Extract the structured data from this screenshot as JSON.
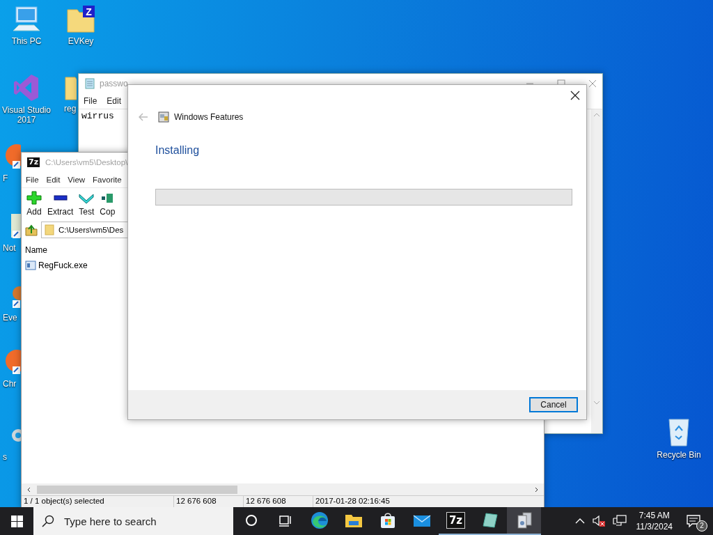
{
  "desktop_icons": [
    {
      "label": "This PC",
      "kind": "computer"
    },
    {
      "label": "EVKey",
      "kind": "folder",
      "badge": "Z"
    },
    {
      "label": "Visual Studio 2017",
      "kind": "visual-studio"
    },
    {
      "label": "reg",
      "kind": "folder"
    },
    {
      "label": "F",
      "kind": "browser"
    },
    {
      "label": "Not",
      "kind": "notepad"
    },
    {
      "label": "Eve",
      "kind": "viewer"
    },
    {
      "label": "Chr",
      "kind": "browser"
    },
    {
      "label": "s",
      "kind": "tool"
    },
    {
      "label": "Recycle Bin",
      "kind": "recycle-bin"
    }
  ],
  "notepad": {
    "title": "passwo",
    "menu": [
      "File",
      "Edit"
    ],
    "text": "wirrus"
  },
  "seven_zip": {
    "logo": "7z",
    "title": "C:\\Users\\vm5\\Desktop\\",
    "menu": [
      "File",
      "Edit",
      "View",
      "Favorite"
    ],
    "toolbar": [
      {
        "label": "Add",
        "kind": "add"
      },
      {
        "label": "Extract",
        "kind": "extract"
      },
      {
        "label": "Test",
        "kind": "test"
      },
      {
        "label": "Cop",
        "kind": "copy"
      }
    ],
    "address": "C:\\Users\\vm5\\Des",
    "columns": [
      "Name"
    ],
    "rows": [
      {
        "name": "RegFuck.exe"
      }
    ],
    "status_bar": [
      "1 / 1 object(s) selected",
      "12 676 608",
      "12 676 608",
      "2017-01-28 02:16:45"
    ]
  },
  "dialog": {
    "title": "Windows Features",
    "heading": "Installing",
    "progress": {
      "level": 0
    },
    "buttons": [
      "Cancel"
    ]
  },
  "taskbar": {
    "search_placeholder": "Type here to search",
    "apps": [
      {
        "kind": "cortana",
        "selected": false,
        "running": false
      },
      {
        "kind": "task-view",
        "selected": false,
        "running": false
      },
      {
        "kind": "edge",
        "selected": false,
        "running": false
      },
      {
        "kind": "explorer",
        "selected": false,
        "running": false
      },
      {
        "kind": "store",
        "selected": false,
        "running": false
      },
      {
        "kind": "mail",
        "selected": false,
        "running": false
      },
      {
        "kind": "archiver",
        "label": "7z",
        "selected": false,
        "running": true
      },
      {
        "kind": "app",
        "selected": false,
        "running": true
      },
      {
        "kind": "features",
        "selected": true,
        "running": true
      }
    ],
    "time": "7:45 AM",
    "date": "11/3/2024",
    "notifications": "2"
  }
}
